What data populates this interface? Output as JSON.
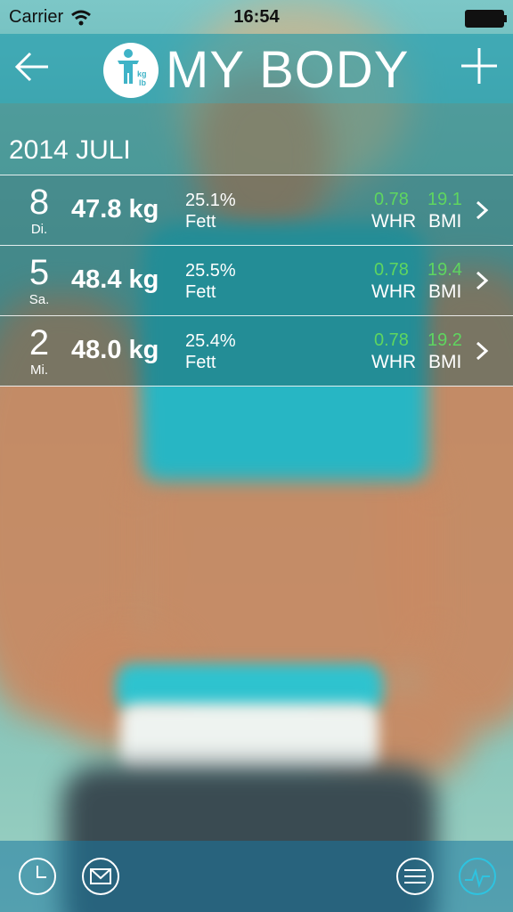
{
  "status": {
    "carrier": "Carrier",
    "time": "16:54"
  },
  "navbar": {
    "title": "MY BODY",
    "logo_units": [
      "kg",
      "lb"
    ]
  },
  "month_header": "2014 JULI",
  "entries": [
    {
      "day": "8",
      "weekday": "Di.",
      "weight": "47.8 kg",
      "fat_value": "25.1%",
      "fat_label": "Fett",
      "whr_value": "0.78",
      "whr_label": "WHR",
      "bmi_value": "19.1",
      "bmi_label": "BMI"
    },
    {
      "day": "5",
      "weekday": "Sa.",
      "weight": "48.4 kg",
      "fat_value": "25.5%",
      "fat_label": "Fett",
      "whr_value": "0.78",
      "whr_label": "WHR",
      "bmi_value": "19.4",
      "bmi_label": "BMI"
    },
    {
      "day": "2",
      "weekday": "Mi.",
      "weight": "48.0 kg",
      "fat_value": "25.4%",
      "fat_label": "Fett",
      "whr_value": "0.78",
      "whr_label": "WHR",
      "bmi_value": "19.2",
      "bmi_label": "BMI"
    }
  ],
  "toolbar": {
    "icons": [
      "clock-icon",
      "mail-icon",
      "menu-icon",
      "chart-icon"
    ]
  },
  "colors": {
    "accent_green": "#5fd65f",
    "active_icon": "#2ec3e0"
  }
}
